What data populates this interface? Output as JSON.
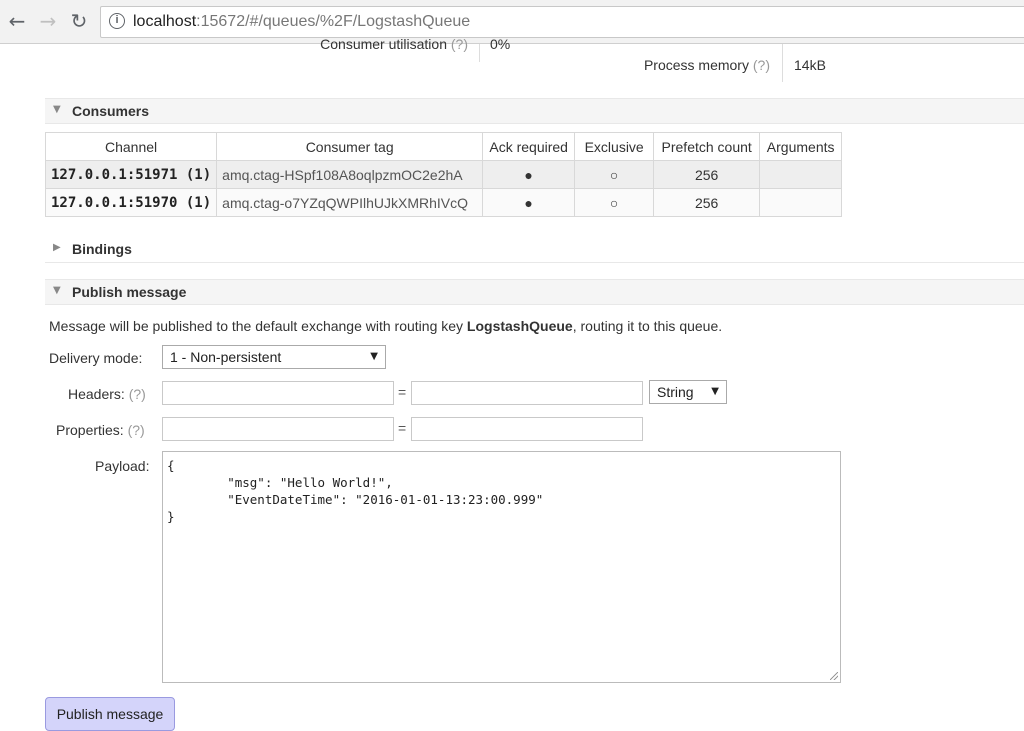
{
  "browser": {
    "url_host": "localhost",
    "url_path": ":15672/#/queues/%2F/LogstashQueue"
  },
  "stats": {
    "consumer_utilisation_label": "Consumer utilisation",
    "consumer_utilisation_value": "0%",
    "process_memory_label": "Process memory",
    "process_memory_value": "14kB",
    "help": "(?)"
  },
  "consumers": {
    "title": "Consumers",
    "columns": [
      "Channel",
      "Consumer tag",
      "Ack required",
      "Exclusive",
      "Prefetch count",
      "Arguments"
    ],
    "rows": [
      {
        "channel": "127.0.0.1:51971 (1)",
        "tag": "amq.ctag-HSpf108A8oqlpzmOC2e2hA",
        "ack": "●",
        "exclusive": "○",
        "prefetch": "256",
        "arguments": ""
      },
      {
        "channel": "127.0.0.1:51970 (1)",
        "tag": "amq.ctag-o7YZqQWPIlhUJkXMRhIVcQ",
        "ack": "●",
        "exclusive": "○",
        "prefetch": "256",
        "arguments": ""
      }
    ]
  },
  "bindings": {
    "title": "Bindings"
  },
  "publish": {
    "title": "Publish message",
    "info_prefix": "Message will be published to the default exchange with routing key ",
    "routing_key": "LogstashQueue",
    "info_suffix": ", routing it to this queue.",
    "delivery_mode_label": "Delivery mode:",
    "delivery_mode_value": "1 - Non-persistent",
    "headers_label": "Headers:",
    "headers_type": "String",
    "properties_label": "Properties:",
    "help": "(?)",
    "equals": "=",
    "payload_label": "Payload:",
    "payload": "{\n        \"msg\": \"Hello World!\",\n        \"EventDateTime\": \"2016-01-01-13:23:00.999\"\n}",
    "button_label": "Publish message"
  }
}
